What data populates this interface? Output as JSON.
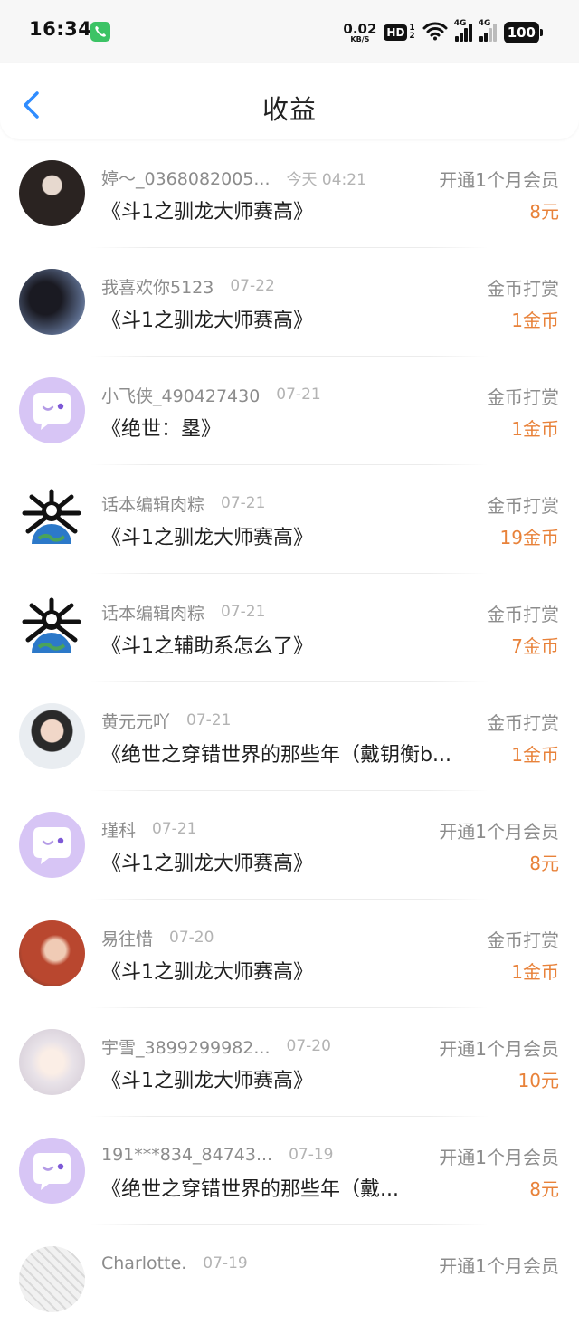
{
  "status_bar": {
    "time": "16:34",
    "net_speed": "0.02",
    "net_unit": "KB/S",
    "hd_label": "HD",
    "hd_sub_top": "1",
    "hd_sub_bottom": "2",
    "sig1_label": "4G",
    "sig2_label": "4G",
    "battery": "100"
  },
  "header": {
    "title": "收益"
  },
  "colors": {
    "accent": "#2f8cff",
    "amount": "#e8823a",
    "avatar_default": "#d7c5f5"
  },
  "entries": [
    {
      "name": "婷～_0368082005...",
      "date": "今天 04:21",
      "book": "《斗1之驯龙大师赛高》",
      "type": "开通1个月会员",
      "amount": "8元",
      "avatar": "photo-dark-hair"
    },
    {
      "name": "我喜欢你5123",
      "date": "07-22",
      "book": "《斗1之驯龙大师赛高》",
      "type": "金币打赏",
      "amount": "1金币",
      "avatar": "silhouette-couple"
    },
    {
      "name": "小飞侠_490427430",
      "date": "07-21",
      "book": "《绝世：塁》",
      "type": "金币打赏",
      "amount": "1金币",
      "avatar": "default-chat-bubble"
    },
    {
      "name": "话本编辑肉粽",
      "date": "07-21",
      "book": "《斗1之驯龙大师赛高》",
      "type": "金币打赏",
      "amount": "19金币",
      "avatar": "earth-creature"
    },
    {
      "name": "话本编辑肉粽",
      "date": "07-21",
      "book": "《斗1之辅助系怎么了》",
      "type": "金币打赏",
      "amount": "7金币",
      "avatar": "earth-creature"
    },
    {
      "name": "黄元元吖",
      "date": "07-21",
      "book": "《绝世之穿错世界的那些年（戴钥衡b...",
      "type": "金币打赏",
      "amount": "1金币",
      "avatar": "photo-boy"
    },
    {
      "name": "瑾科",
      "date": "07-21",
      "book": "《斗1之驯龙大师赛高》",
      "type": "开通1个月会员",
      "amount": "8元",
      "avatar": "default-chat-bubble"
    },
    {
      "name": "易往惜",
      "date": "07-20",
      "book": "《斗1之驯龙大师赛高》",
      "type": "金币打赏",
      "amount": "1金币",
      "avatar": "photo-red-hair"
    },
    {
      "name": "宇雪_3899299982...",
      "date": "07-20",
      "book": "《斗1之驯龙大师赛高》",
      "type": "开通1个月会员",
      "amount": "10元",
      "avatar": "anime-white-hair"
    },
    {
      "name": "191***834_84743...",
      "date": "07-19",
      "book": "《绝世之穿错世界的那些年（戴...",
      "type": "开通1个月会员",
      "amount": "8元",
      "avatar": "default-chat-bubble"
    },
    {
      "name": "Charlotte.",
      "date": "07-19",
      "book": "",
      "type": "开通1个月会员",
      "amount": "",
      "avatar": "comic-sketch"
    }
  ]
}
